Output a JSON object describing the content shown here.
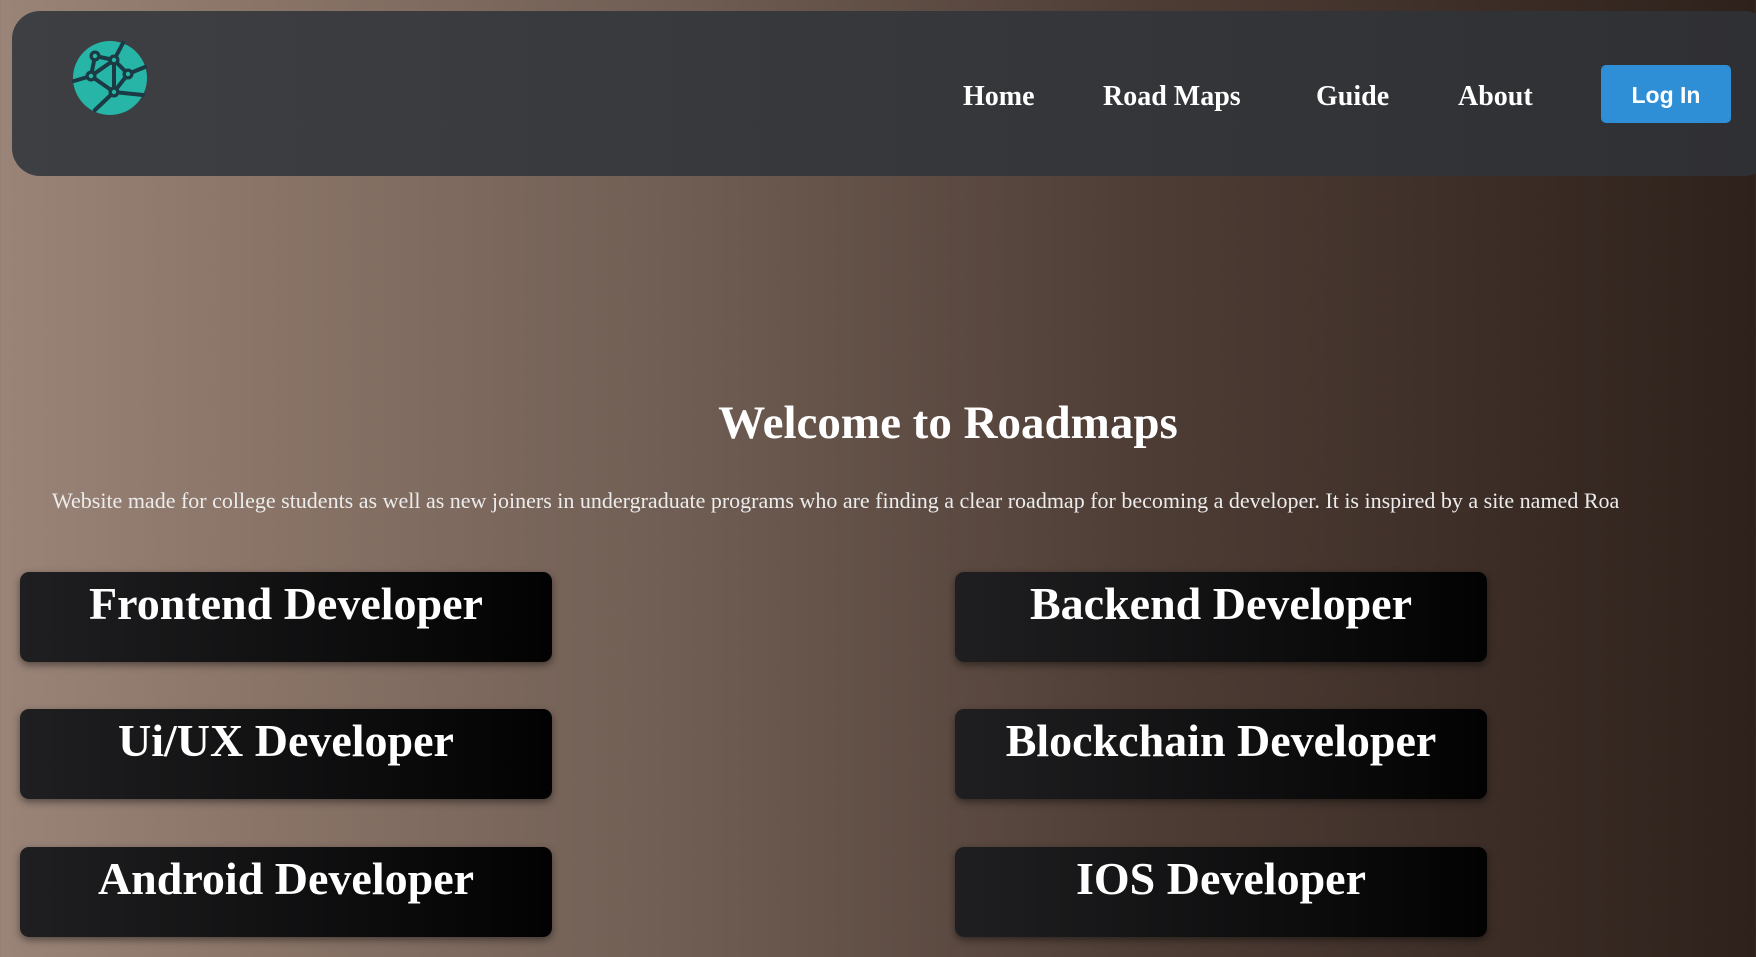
{
  "nav": {
    "logo_icon": "globe-network-icon",
    "links": [
      "Home",
      "Road Maps",
      "Guide",
      "About"
    ],
    "login_label": "Log In"
  },
  "hero": {
    "title": "Welcome to Roadmaps",
    "description": "Website made for college students as well as new joiners in undergraduate programs who are finding a clear roadmap for becoming a developer. It is inspired by a site named Roa"
  },
  "cards": [
    "Frontend Developer",
    "Backend Developer",
    "Ui/UX Developer",
    "Blockchain Developer",
    "Android Developer",
    "IOS Developer"
  ],
  "colors": {
    "accent": "#2f8fd6",
    "logo": "#27b5a8"
  }
}
